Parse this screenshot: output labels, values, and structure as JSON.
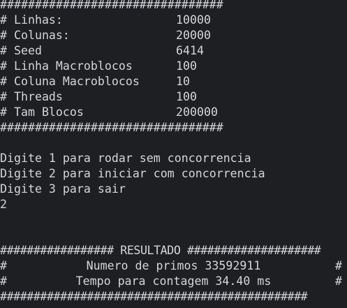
{
  "config": {
    "border": "################################",
    "rows": [
      {
        "key": "# Linhas:",
        "value": "10000"
      },
      {
        "key": "# Colunas:",
        "value": "20000"
      },
      {
        "key": "# Seed",
        "value": "6414"
      },
      {
        "key": "# Linha Macroblocos",
        "value": "100"
      },
      {
        "key": "# Coluna Macroblocos",
        "value": "10"
      },
      {
        "key": "# Threads",
        "value": "100"
      },
      {
        "key": "# Tam Blocos",
        "value": "200000"
      }
    ]
  },
  "menu": {
    "option1": "Digite 1 para rodar sem concorrencia",
    "option2": "Digite 2 para iniciar com concorrencia",
    "option3": "Digite 3 para sair",
    "user_input": "2"
  },
  "result": {
    "header": "################# RESULTADO ####################",
    "hash": "#",
    "primes_line": "Numero de primos 33592911",
    "time_line": "Tempo para contagem 34.40 ms",
    "footer": "##############################################"
  },
  "colors": {
    "background": "#1e1f22",
    "text": "#d3d6db"
  }
}
